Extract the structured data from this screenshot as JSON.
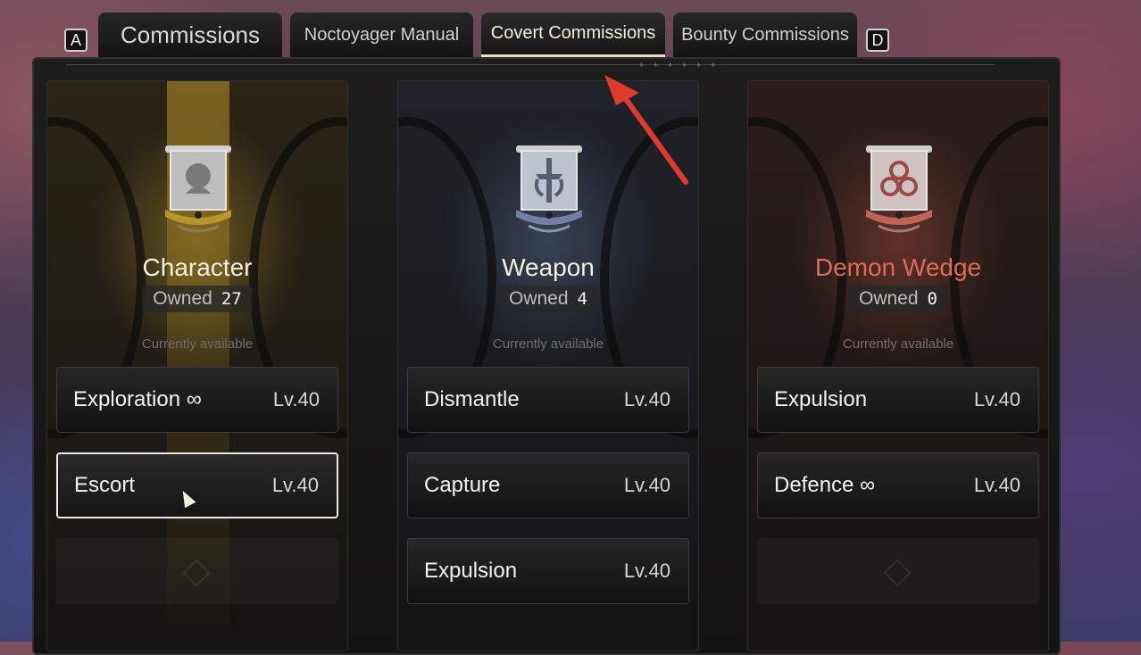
{
  "tabs": {
    "left_key": "A",
    "right_key": "D",
    "items": [
      {
        "label": "Commissions"
      },
      {
        "label": "Noctoyager Manual"
      },
      {
        "label": "Covert Commissions"
      },
      {
        "label": "Bounty Commissions"
      }
    ],
    "active_index": 2
  },
  "colors": {
    "character_accent": "#b8962e",
    "weapon_accent": "#6f7fa8",
    "demon_wedge_accent": "#e06a5a",
    "annotation_arrow": "#e03a2f"
  },
  "categories": [
    {
      "title": "Character",
      "owned_label": "Owned",
      "owned_count": "27",
      "availability": "Currently available",
      "icon": "character-emblem-icon",
      "commissions": [
        {
          "label": "Exploration ∞",
          "level": "Lv.40"
        },
        {
          "label": "Escort",
          "level": "Lv.40"
        }
      ]
    },
    {
      "title": "Weapon",
      "owned_label": "Owned",
      "owned_count": "4",
      "availability": "Currently available",
      "icon": "weapon-emblem-icon",
      "commissions": [
        {
          "label": "Dismantle",
          "level": "Lv.40"
        },
        {
          "label": "Capture",
          "level": "Lv.40"
        },
        {
          "label": "Expulsion",
          "level": "Lv.40"
        }
      ]
    },
    {
      "title": "Demon Wedge",
      "owned_label": "Owned",
      "owned_count": "0",
      "availability": "Currently available",
      "icon": "demon-wedge-emblem-icon",
      "commissions": [
        {
          "label": "Expulsion",
          "level": "Lv.40"
        },
        {
          "label": "Defence ∞",
          "level": "Lv.40"
        }
      ]
    }
  ]
}
